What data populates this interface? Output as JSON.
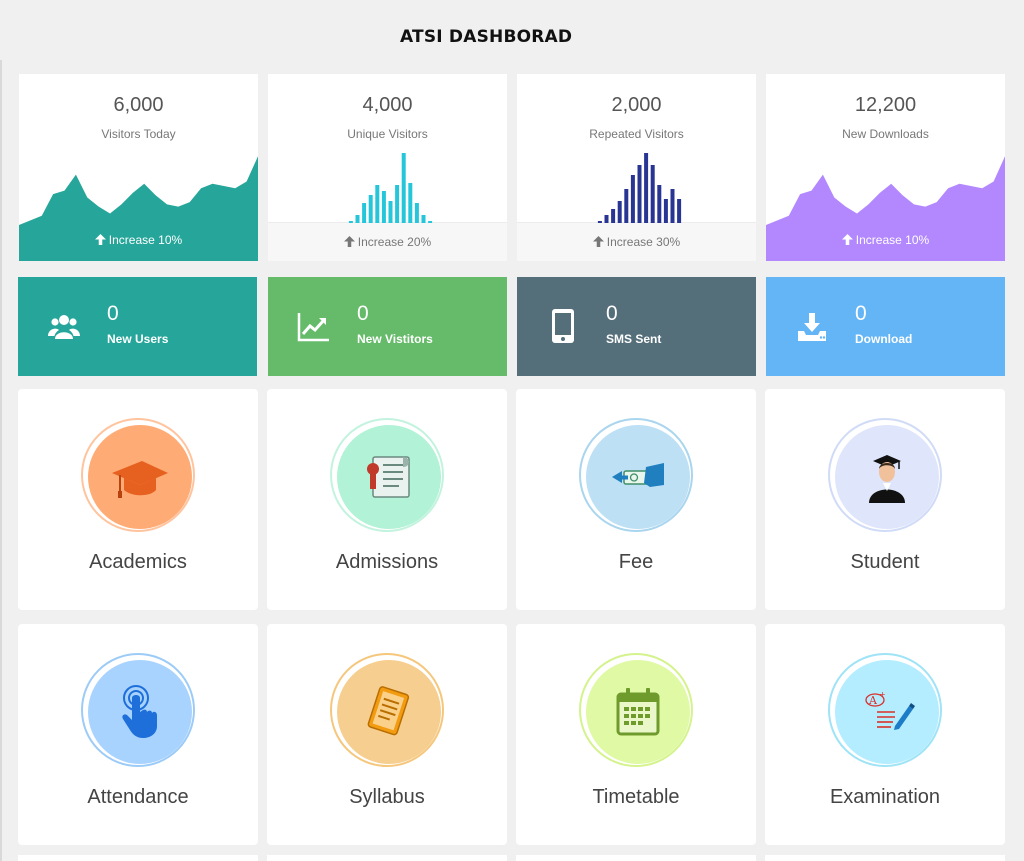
{
  "header": {
    "title": "ATSI DASHBORAD"
  },
  "stats": [
    {
      "value": "6,000",
      "label": "Visitors Today",
      "trend": "Increase 10%",
      "color": "#26a69a",
      "chart": "area",
      "series": [
        28,
        32,
        36,
        55,
        58,
        72,
        52,
        44,
        38,
        46,
        56,
        64,
        54,
        46,
        44,
        48,
        60,
        64,
        62,
        60,
        66,
        88
      ]
    },
    {
      "value": "4,000",
      "label": "Unique Visitors",
      "trend": "Increase 20%",
      "color": "#26c6da",
      "chart": "bars",
      "series": [
        2,
        8,
        20,
        28,
        38,
        32,
        22,
        38,
        70,
        40,
        20,
        8,
        2
      ]
    },
    {
      "value": "2,000",
      "label": "Repeated Visitors",
      "trend": "Increase 30%",
      "color": "#283593",
      "chart": "bars",
      "series": [
        2,
        8,
        14,
        22,
        34,
        48,
        58,
        70,
        58,
        38,
        24,
        34,
        24
      ]
    },
    {
      "value": "12,200",
      "label": "New Downloads",
      "trend": "Increase 10%",
      "color": "#b388ff",
      "chart": "area",
      "series": [
        28,
        32,
        36,
        55,
        58,
        72,
        52,
        44,
        38,
        46,
        56,
        64,
        54,
        46,
        44,
        48,
        60,
        64,
        62,
        60,
        66,
        88
      ]
    }
  ],
  "tiles": [
    {
      "value": "0",
      "label": "New Users",
      "icon": "users-icon",
      "color": "#26a69a"
    },
    {
      "value": "0",
      "label": "New Vistitors",
      "icon": "chart-line-icon",
      "color": "#66bb6a"
    },
    {
      "value": "0",
      "label": "SMS Sent",
      "icon": "mobile-icon",
      "color": "#546e7a"
    },
    {
      "value": "0",
      "label": "Download",
      "icon": "download-icon",
      "color": "#64b5f6"
    }
  ],
  "modules": [
    {
      "label": "Academics",
      "icon": "graduation-cap-icon",
      "fill": "#ffab76",
      "ring": "#ffc49e"
    },
    {
      "label": "Admissions",
      "icon": "scroll-certificate-icon",
      "fill": "#b2f2d6",
      "ring": "#c3f3de"
    },
    {
      "label": "Fee",
      "icon": "money-hand-icon",
      "fill": "#bde0f5",
      "ring": "#a9d5ef"
    },
    {
      "label": "Student",
      "icon": "graduate-student-icon",
      "fill": "#dfe6fb",
      "ring": "#d0dbf7"
    },
    {
      "label": "Attendance",
      "icon": "touch-hand-icon",
      "fill": "#a9d3ff",
      "ring": "#9ccbf7"
    },
    {
      "label": "Syllabus",
      "icon": "document-list-icon",
      "fill": "#f6cf90",
      "ring": "#f5c77d"
    },
    {
      "label": "Timetable",
      "icon": "calendar-icon",
      "fill": "#e0f9a4",
      "ring": "#d4f38d"
    },
    {
      "label": "Examination",
      "icon": "exam-grade-icon",
      "fill": "#b3edff",
      "ring": "#9fe3f7"
    }
  ]
}
